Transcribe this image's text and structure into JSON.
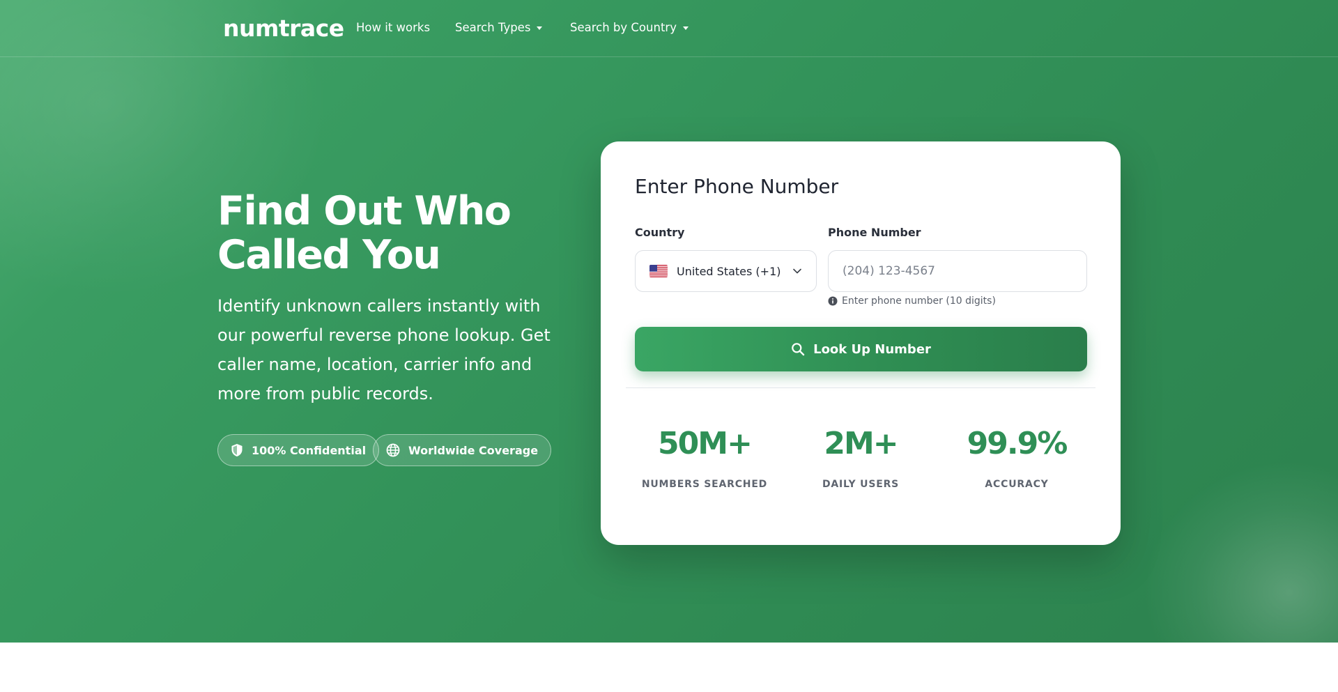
{
  "brand": {
    "logo": "numtrace"
  },
  "nav": {
    "items": [
      {
        "label": "How it works",
        "dropdown": false
      },
      {
        "label": "Search Types",
        "dropdown": true
      },
      {
        "label": "Search by Country",
        "dropdown": true
      }
    ]
  },
  "hero": {
    "headline": "Find Out Who Called You",
    "subtext": "Identify unknown callers instantly with our powerful reverse phone lookup. Get caller name, location, carrier info and more from public records.",
    "badges": [
      {
        "label": "100% Confidential",
        "icon": "shield-icon"
      },
      {
        "label": "Worldwide Coverage",
        "icon": "globe-icon"
      }
    ]
  },
  "form": {
    "title": "Enter Phone Number",
    "country_label": "Country",
    "country_value": "United States (+1)",
    "phone_label": "Phone Number",
    "phone_placeholder": "(204) 123-4567",
    "hint": "Enter phone number (10 digits)",
    "button_label": "Look Up Number"
  },
  "stats": [
    {
      "value": "50M+",
      "label": "NUMBERS SEARCHED"
    },
    {
      "value": "2M+",
      "label": "DAILY USERS"
    },
    {
      "value": "99.9%",
      "label": "ACCURACY"
    }
  ],
  "colors": {
    "brand_green": "#33935a",
    "button_green": "#2f8e53",
    "stat_green": "#2f8f56"
  }
}
